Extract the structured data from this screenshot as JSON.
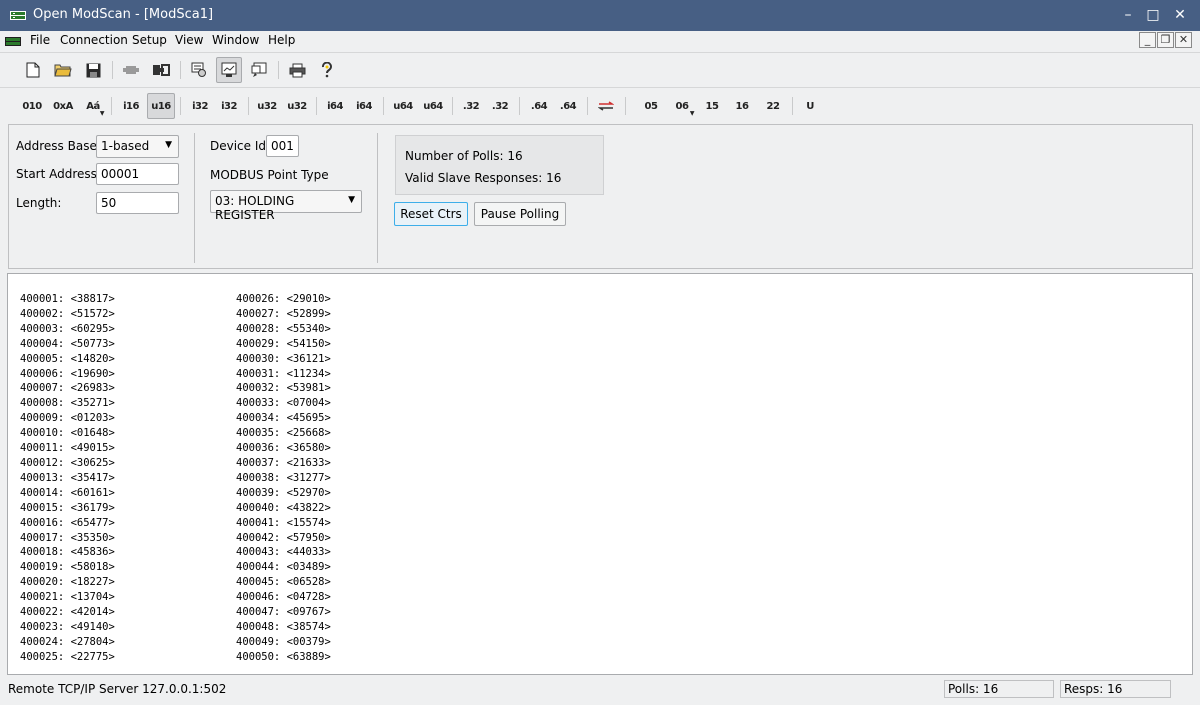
{
  "window": {
    "title": "Open ModScan - [ModSca1]",
    "minimize_glyph": "–",
    "maximize_glyph": "□",
    "close_glyph": "✕"
  },
  "menu": {
    "items": [
      "File",
      "Connection",
      "Setup",
      "View",
      "Window",
      "Help"
    ],
    "mdi_minimize": "_",
    "mdi_restore": "❐",
    "mdi_close": "✕"
  },
  "toolbar_icons": [
    "new-file-icon",
    "open-folder-icon",
    "save-icon",
    "disconnect-icon",
    "connect-icon",
    "data-definition-icon",
    "show-traffic-icon",
    "log-icon",
    "print-icon",
    "help-icon"
  ],
  "format_toolbar": {
    "binary": "010",
    "hex": "0xA",
    "ansi": "Aá",
    "i16": "i16",
    "u16": "u16",
    "i32": "i32",
    "i32_swapped": "i32",
    "u32": "u32",
    "u32_swapped": "u32",
    "i64": "i64",
    "i64_swapped": "i64",
    "u64": "u64",
    "u64_swapped": "u64",
    "float": ".32",
    "float_swapped": ".32",
    "double": ".64",
    "double_swapped": ".64",
    "byte_order_icon": "swap-arrows-icon",
    "fc05": "05",
    "fc06": "06",
    "fc15": "15",
    "fc16": "16",
    "fc22": "22",
    "user_fc": "U",
    "active_format": "u16"
  },
  "settings": {
    "address_base_label": "Address Base:",
    "address_base_value": "1-based",
    "start_address_label": "Start Address:",
    "start_address_value": "00001",
    "length_label": "Length:",
    "length_value": "50",
    "device_id_label": "Device Id:",
    "device_id_value": "001",
    "point_type_label": "MODBUS Point Type",
    "point_type_value": "03: HOLDING REGISTER"
  },
  "stats": {
    "polls_text": "Number of Polls: 16",
    "responses_text": "Valid Slave Responses: 16",
    "reset_button": "Reset Ctrs",
    "pause_button": "Pause Polling"
  },
  "registers": {
    "column1": [
      "400001: <38817>",
      "400002: <51572>",
      "400003: <60295>",
      "400004: <50773>",
      "400005: <14820>",
      "400006: <19690>",
      "400007: <26983>",
      "400008: <35271>",
      "400009: <01203>",
      "400010: <01648>",
      "400011: <49015>",
      "400012: <30625>",
      "400013: <35417>",
      "400014: <60161>",
      "400015: <36179>",
      "400016: <65477>",
      "400017: <35350>",
      "400018: <45836>",
      "400019: <58018>",
      "400020: <18227>",
      "400021: <13704>",
      "400022: <42014>",
      "400023: <49140>",
      "400024: <27804>",
      "400025: <22775>"
    ],
    "column2": [
      "400026: <29010>",
      "400027: <52899>",
      "400028: <55340>",
      "400029: <54150>",
      "400030: <36121>",
      "400031: <11234>",
      "400032: <53981>",
      "400033: <07004>",
      "400034: <45695>",
      "400035: <25668>",
      "400036: <36580>",
      "400037: <21633>",
      "400038: <31277>",
      "400039: <52970>",
      "400040: <43822>",
      "400041: <15574>",
      "400042: <57950>",
      "400043: <44033>",
      "400044: <03489>",
      "400045: <06528>",
      "400046: <04728>",
      "400047: <09767>",
      "400048: <38574>",
      "400049: <00379>",
      "400050: <63889>"
    ]
  },
  "status": {
    "connection": "Remote TCP/IP Server 127.0.0.1:502",
    "polls": "Polls: 16",
    "resps": "Resps: 16"
  },
  "colors": {
    "titlebar": "#475f84",
    "accent": "#3daee9",
    "swapped_mark": "#d03030"
  }
}
